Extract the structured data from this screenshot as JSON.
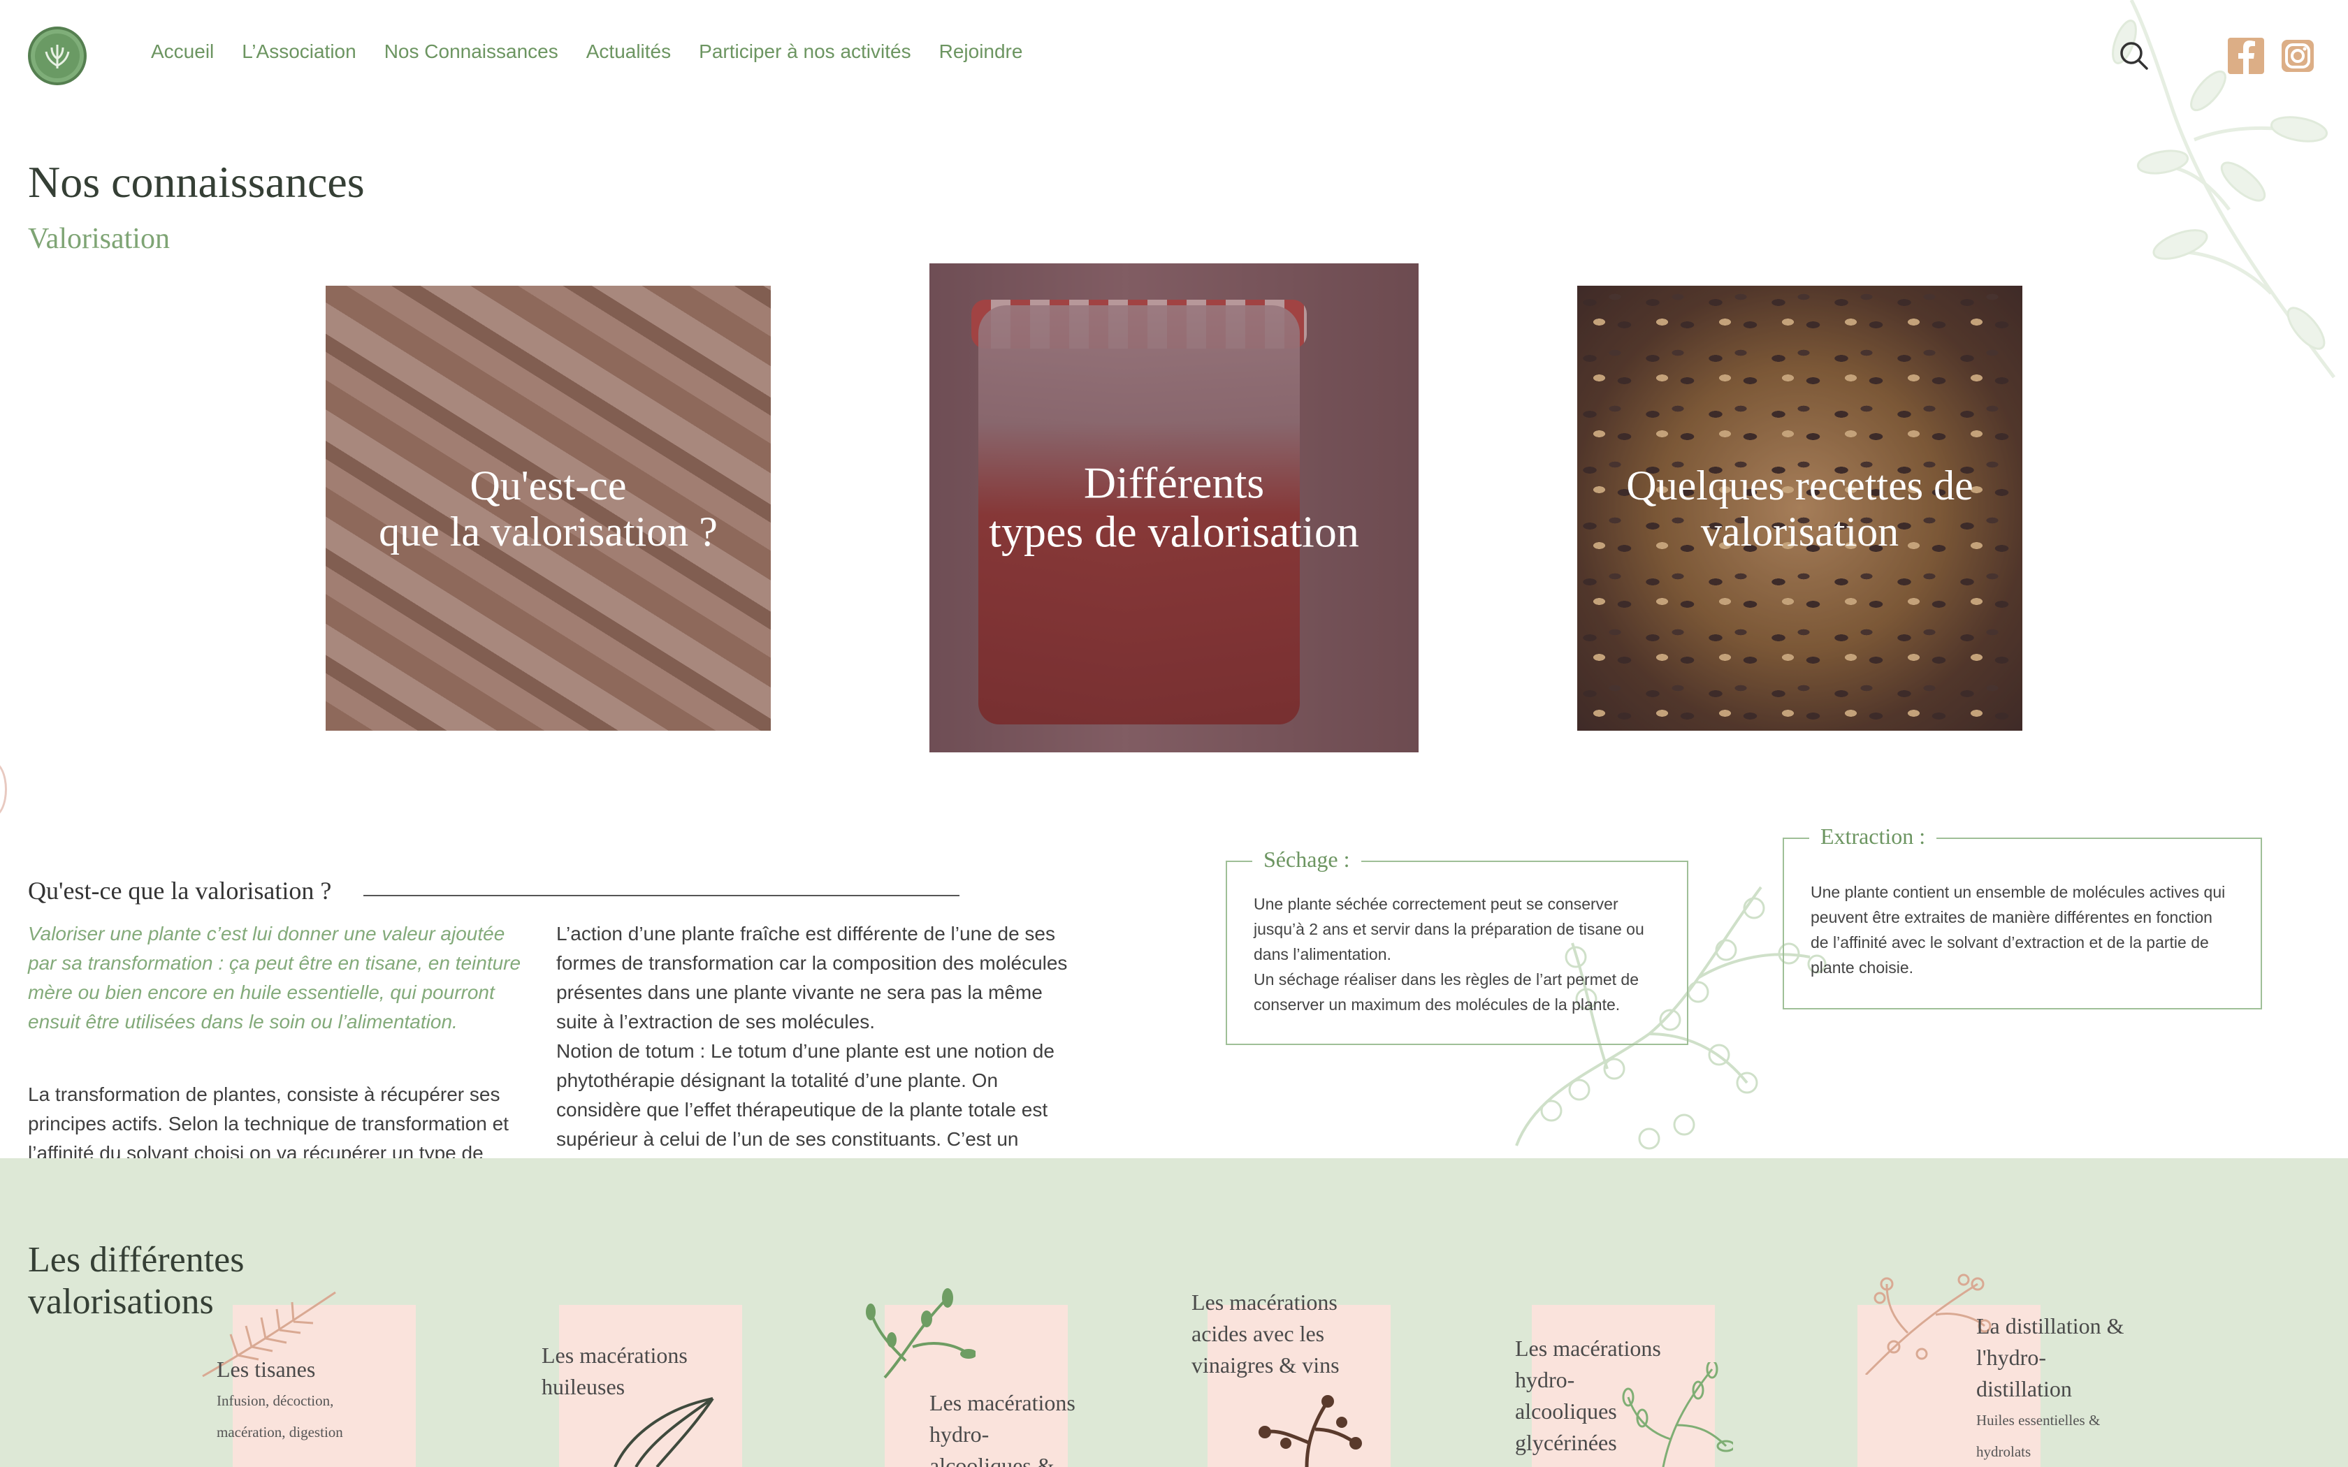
{
  "header": {
    "nav": [
      "Accueil",
      "L’Association",
      "Nos Connaissances",
      "Actualités",
      "Participer à nos activités",
      "Rejoindre"
    ]
  },
  "page": {
    "title": "Nos connaissances",
    "subtitle": "Valorisation"
  },
  "cards": [
    {
      "line1": "Qu'est-ce",
      "line2": "que la valorisation ?"
    },
    {
      "line1": "Différents",
      "line2": "types de valorisation"
    },
    {
      "line1": "Quelques recettes de",
      "line2": "valorisation"
    }
  ],
  "intro": {
    "heading": "Qu'est-ce que la valorisation ?",
    "italic": "Valoriser une plante c’est lui donner une valeur ajoutée par sa transformation : ça peut être en tisane, en teinture mère ou bien encore en huile essentielle, qui pourront ensuit être utilisées dans le soin ou l’alimentation.",
    "paragraph": "La transformation de plantes, consiste à récupérer ses principes actifs. Selon la technique de transformation et l’affinité du solvant choisi on va récupérer un type de famille de molécules.",
    "col2_p1": "L’action d’une plante fraîche est différente de l’une de ses formes de transformation car la composition des molécules présentes dans une plante vivante ne sera pas la même suite à l’extraction de ses molécules.",
    "col2_p2": "Notion de totum : Le totum d’une plante est une notion de phytothérapie désignant la totalité d’une plante. On considère que l’effet thérapeutique de la plante totale est supérieur à celui de l’un de ses constituants. C’est un ensemble cohérent de principes actifs d’action synergique."
  },
  "boxes": {
    "sechage": {
      "label": "Séchage :",
      "text1": "Une plante séchée correctement peut se conserver jusqu’à 2 ans et servir dans la préparation de tisane ou dans l’alimentation.",
      "text2": "Un séchage réaliser dans les règles de l’art permet de conserver un maximum des molécules de la plante."
    },
    "extraction": {
      "label": "Extraction :",
      "text": "Une plante contient un ensemble de molécules actives qui peuvent être extraites de manière différentes en fonction de l’affinité avec le solvant d’extraction et de la partie de plante choisie."
    }
  },
  "valorisations": {
    "title_line1": "Les différentes",
    "title_line2": "valorisations",
    "items": [
      {
        "title": "Les tisanes",
        "sub1": "Infusion, décoction,",
        "sub2": "macération, digestion"
      },
      {
        "title1": "Les macérations",
        "title2": "huileuses"
      },
      {
        "title1": "Les macérations",
        "title2": "hydro-",
        "title3": "alcooliques &"
      },
      {
        "title1": "Les macérations",
        "title2": "acides avec les",
        "title3": "vinaigres & vins"
      },
      {
        "title1": "Les macérations",
        "title2": "hydro-",
        "title3": "alcooliques",
        "title4": "glycérinées"
      },
      {
        "title1": "La distillation &",
        "title2": "l'hydro-",
        "title3": "distillation",
        "sub1": "Huiles essentielles &",
        "sub2": "hydrolats"
      }
    ]
  },
  "colors": {
    "accent_green": "#6c9561",
    "light_green_band": "#dde8d6",
    "pink_card": "#fae3dc",
    "overlay": "#703c40"
  },
  "icons": [
    "logo-icon",
    "search-icon",
    "facebook-icon",
    "instagram-icon"
  ]
}
